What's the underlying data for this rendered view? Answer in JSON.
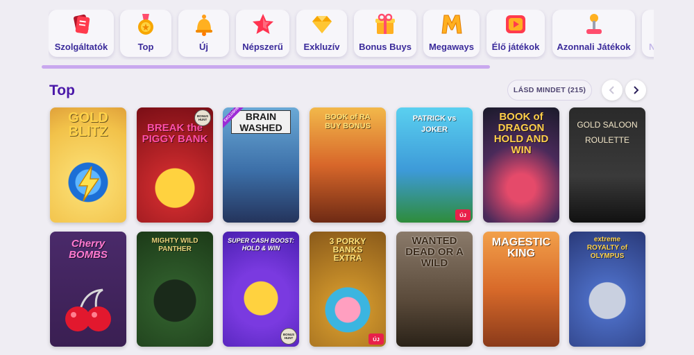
{
  "categories": [
    {
      "label": "Szolgáltatók",
      "icon": "cards-icon"
    },
    {
      "label": "Top",
      "icon": "medal-icon"
    },
    {
      "label": "Új",
      "icon": "bell-icon"
    },
    {
      "label": "Népszerű",
      "icon": "star-icon"
    },
    {
      "label": "Exkluzív",
      "icon": "gem-icon"
    },
    {
      "label": "Bonus Buys",
      "icon": "gift-icon"
    },
    {
      "label": "Megaways",
      "icon": "megaways-icon"
    },
    {
      "label": "Élő játékok",
      "icon": "play-icon"
    },
    {
      "label": "Azonnali Játékok",
      "icon": "joystick-icon"
    },
    {
      "label": "N",
      "icon": "more-icon"
    }
  ],
  "section": {
    "title": "Top",
    "see_all": "LÁSD MINDET (215)"
  },
  "games": [
    {
      "title": "GOLD\nBLITZ",
      "badge_new": null,
      "exclusive": null,
      "hunt": null
    },
    {
      "title": "BREAK the\nPIGGY BANK",
      "badge_new": null,
      "exclusive": null,
      "hunt": "BONUS\nHUNT"
    },
    {
      "title": "BRAIN\nWASHED",
      "badge_new": null,
      "exclusive": "EXCLUSIVE",
      "hunt": null
    },
    {
      "title": "BOOK of RA\nBUY BONUS",
      "badge_new": null,
      "exclusive": null,
      "hunt": null
    },
    {
      "title": "PATRICK vs JOKER",
      "badge_new": "ÚJ",
      "exclusive": null,
      "hunt": null
    },
    {
      "title": "BOOK of\nDRAGON\nHOLD AND WIN",
      "badge_new": null,
      "exclusive": null,
      "hunt": null
    },
    {
      "title": "GOLD SALOON\nROULETTE",
      "badge_new": null,
      "exclusive": null,
      "hunt": null
    },
    {
      "title": "Cherry\nBOMBS",
      "badge_new": null,
      "exclusive": null,
      "hunt": null
    },
    {
      "title": "MIGHTY WILD\nPANTHER",
      "badge_new": null,
      "exclusive": null,
      "hunt": null
    },
    {
      "title": "SUPER CASH BOOST:\nHOLD & WIN",
      "badge_new": null,
      "exclusive": null,
      "hunt": "BONUS\nHUNT"
    },
    {
      "title": "3 PORKY\nBANKS\nEXTRA",
      "badge_new": "ÚJ",
      "exclusive": null,
      "hunt": null
    },
    {
      "title": "WANTED\nDEAD OR A WILD",
      "badge_new": null,
      "exclusive": null,
      "hunt": null
    },
    {
      "title": "MAGESTIC\nKING",
      "badge_new": null,
      "exclusive": null,
      "hunt": null
    },
    {
      "title": "extreme\nROYALTY of OLYMPUS",
      "badge_new": null,
      "exclusive": null,
      "hunt": null
    }
  ],
  "colors": {
    "accent": "#4a18a8",
    "progress": "#c9a8ee",
    "new_badge": "#e8204a"
  }
}
